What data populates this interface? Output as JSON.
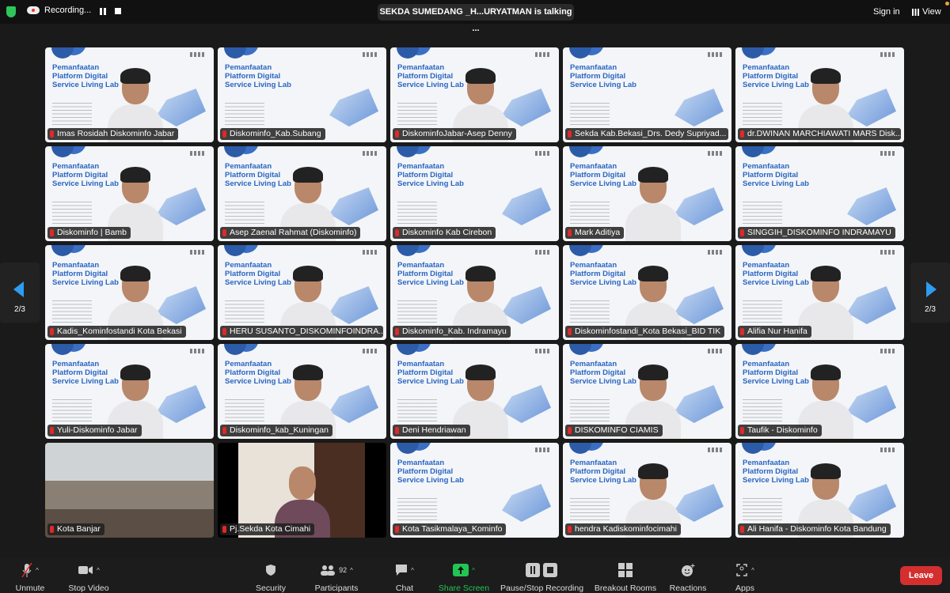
{
  "topbar": {
    "recording_label": "Recording...",
    "talking": "SEKDA SUMEDANG _H...URYATMAN is talking ...",
    "sign_in": "Sign in",
    "view": "View"
  },
  "slide": {
    "title": "Pemanfaatan Platform Digital Service Living Lab"
  },
  "pagination": {
    "left": "2/3",
    "right": "2/3"
  },
  "tiles": [
    {
      "name": "Imas Rosidah Diskominfo Jabar",
      "video": "slide-person"
    },
    {
      "name": "Diskominfo_Kab.Subang",
      "video": "slide"
    },
    {
      "name": "DiskominfoJabar-Asep Denny",
      "video": "slide-person"
    },
    {
      "name": "Sekda Kab.Bekasi_Drs. Dedy Supriyad...",
      "video": "slide"
    },
    {
      "name": "dr.DWINAN MARCHIAWATI MARS Disk...",
      "video": "slide-person"
    },
    {
      "name": "Diskominfo | Bamb",
      "video": "slide-person"
    },
    {
      "name": "Asep Zaenal Rahmat (Diskominfo)",
      "video": "slide-person"
    },
    {
      "name": "Diskominfo Kab Cirebon",
      "video": "slide"
    },
    {
      "name": "Mark Aditiya",
      "video": "slide-person"
    },
    {
      "name": "SINGGIH_DISKOMINFO INDRAMAYU",
      "video": "slide"
    },
    {
      "name": "Kadis_Kominfostandi Kota Bekasi",
      "video": "slide-person"
    },
    {
      "name": "HERU SUSANTO_DISKOMINFOINDRA...",
      "video": "slide-person"
    },
    {
      "name": "Diskominfo_Kab. Indramayu",
      "video": "slide-person"
    },
    {
      "name": "Diskominfostandi_Kota Bekasi_BID TIK",
      "video": "slide-person"
    },
    {
      "name": "Alifia Nur Hanifa",
      "video": "slide-person"
    },
    {
      "name": "Yuli-Diskominfo Jabar",
      "video": "slide-person"
    },
    {
      "name": "Diskominfo_kab_Kuningan",
      "video": "slide-person"
    },
    {
      "name": "Deni Hendriawan",
      "video": "slide-person"
    },
    {
      "name": "DISKOMINFO CIAMIS",
      "video": "slide-person"
    },
    {
      "name": "Taufik  - Diskominfo",
      "video": "slide-person"
    },
    {
      "name": "Kota Banjar",
      "video": "photo1"
    },
    {
      "name": "Pj.Sekda Kota Cimahi",
      "video": "photo2"
    },
    {
      "name": "Kota Tasikmalaya_Kominfo",
      "video": "slide"
    },
    {
      "name": "hendra Kadiskominfocimahi",
      "video": "slide-person"
    },
    {
      "name": "Ali Hanifa - Diskominfo Kota Bandung",
      "video": "slide-person"
    }
  ],
  "toolbar": {
    "unmute": "Unmute",
    "stop_video": "Stop Video",
    "security": "Security",
    "participants": "Participants",
    "participants_count": "92",
    "chat": "Chat",
    "share_screen": "Share Screen",
    "pause_stop": "Pause/Stop Recording",
    "breakout": "Breakout Rooms",
    "reactions": "Reactions",
    "apps": "Apps",
    "leave": "Leave"
  },
  "colors": {
    "share": "#23c552",
    "leave": "#d32f2f",
    "accent": "#2e9cf0",
    "muted_mic": "#e02828"
  }
}
